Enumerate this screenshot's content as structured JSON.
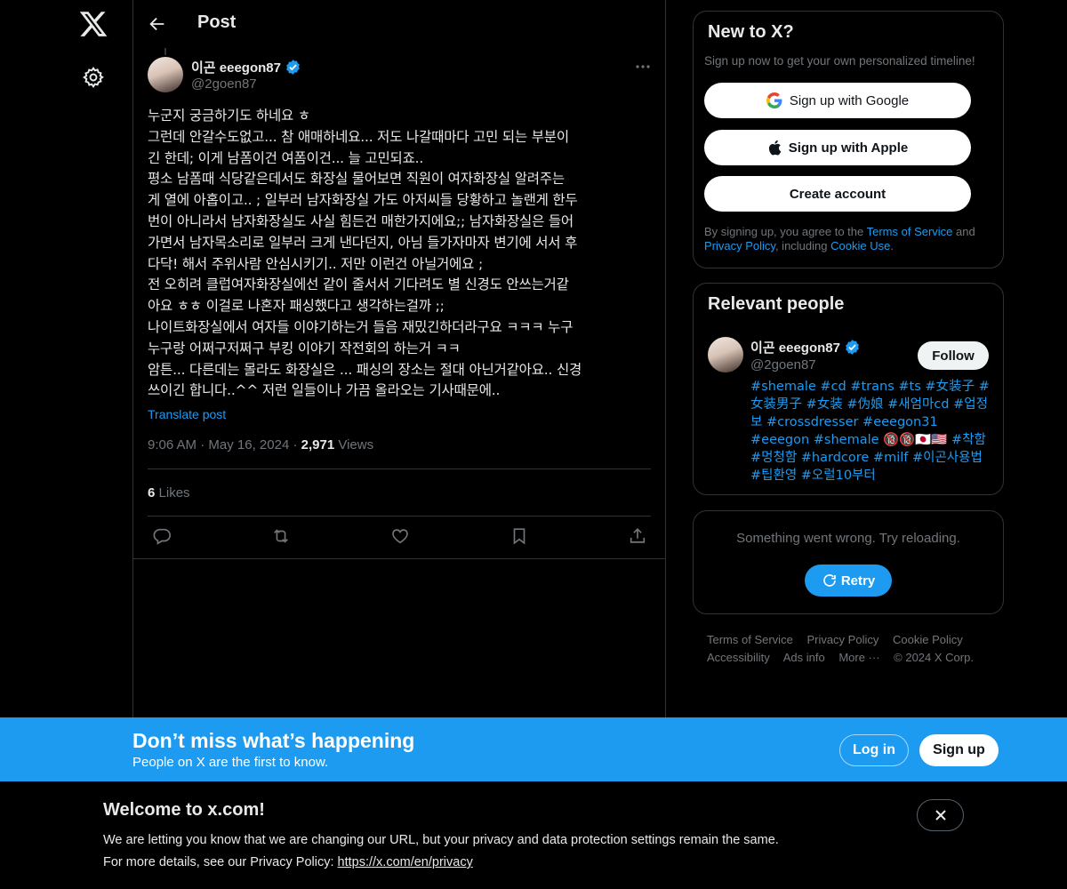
{
  "nav": {
    "logo_icon": "x-logo-icon",
    "settings_icon": "gear-icon"
  },
  "header": {
    "title": "Post"
  },
  "post": {
    "author_name": "이곤 eeegon87",
    "author_handle": "@2goen87",
    "text": "누군지 궁금하기도 하네요 ㅎ\n그런데 안갈수도없고... 참 애매하네요... 저도 나갈때마다 고민 되는 부분이\n긴 한데; 이게 남폼이건 여폼이건... 늘 고민되죠..\n평소 남폼때 식당같은데서도 화장실 물어보면 직원이 여자화장실 알려주는\n게 열에 아홉이고.. ; 일부러 남자화장실 가도 아저씨들 당황하고 놀랜게 한두\n번이 아니라서 남자화장실도 사실 힘든건 매한가지에요;; 남자화장실은 들어\n가면서 남자목소리로 일부러 크게 낸다던지, 아님 들가자마자 변기에 서서 후\n다닥! 해서 주위사람 안심시키기.. 저만 이런건 아닐거에요 ;\n전 오히려 클럽여자화장실에선 같이 줄서서 기다려도 별 신경도 안쓰는거같\n아요 ㅎㅎ 이걸로 나혼자 패싱했다고 생각하는걸까 ;;\n나이트화장실에서 여자들 이야기하는거 들음 재밌긴하더라구요 ㅋㅋㅋ 누구\n누구랑 어쩌구저쩌구 부킹 이야기 작전회의 하는거 ㅋㅋ\n암튼... 다른데는 몰라도 화장실은 ... 패싱의 장소는 절대 아닌거같아요.. 신경\n쓰이긴 합니다..^^ 저런 일들이나 가끔 올라오는 기사때문에..",
    "translate": "Translate post",
    "time": "9:06 AM",
    "date": "May 16, 2024",
    "views_count": "2,971",
    "views_label": "Views",
    "likes_count": "6",
    "likes_label": "Likes",
    "actions": [
      "reply-icon",
      "repost-icon",
      "like-icon",
      "bookmark-icon",
      "share-icon"
    ]
  },
  "signup": {
    "title": "New to X?",
    "subtitle": "Sign up now to get your own personalized timeline!",
    "google": "Sign up with Google",
    "apple": "Sign up with Apple",
    "create": "Create account",
    "legal_1": "By signing up, you agree to the ",
    "terms": "Terms of Service",
    "legal_2": " and ",
    "privacy": "Privacy Policy",
    "legal_3": ", including ",
    "cookie": "Cookie Use",
    "legal_4": "."
  },
  "people": {
    "title": "Relevant people",
    "name": "이곤 eeegon87",
    "handle": "@2goen87",
    "follow": "Follow",
    "bio": "#shemale #cd #trans #ts #女装子 #女装男子 #女装 #伪娘 #새엄마cd #업정보 #crossdresser #eeegon31 #eeegon #shemale 🔞🔞🇯🇵🇺🇸 #착함 #멍청함 #hardcore #milf #이곤사용법 #팁환영 #오럴10부터"
  },
  "error": {
    "message": "Something went wrong. Try reloading.",
    "retry": "Retry"
  },
  "footer": {
    "terms": "Terms of Service",
    "privacy": "Privacy Policy",
    "cookie": "Cookie Policy",
    "accessibility": "Accessibility",
    "ads": "Ads info",
    "more": "More ···",
    "copyright": "© 2024 X Corp."
  },
  "banner": {
    "title": "Don’t miss what’s happening",
    "subtitle": "People on X are the first to know.",
    "login": "Log in",
    "signup": "Sign up"
  },
  "welcome": {
    "title": "Welcome to x.com!",
    "line1": "We are letting you know that we are changing our URL, but your privacy and data protection settings remain the same.",
    "line2": "For more details, see our Privacy Policy: ",
    "link": "https://x.com/en/privacy"
  },
  "colors": {
    "accent": "#1d9bf0",
    "background": "#000000",
    "text": "#e7e9ea",
    "muted": "#71767b",
    "border": "#2f3336"
  }
}
